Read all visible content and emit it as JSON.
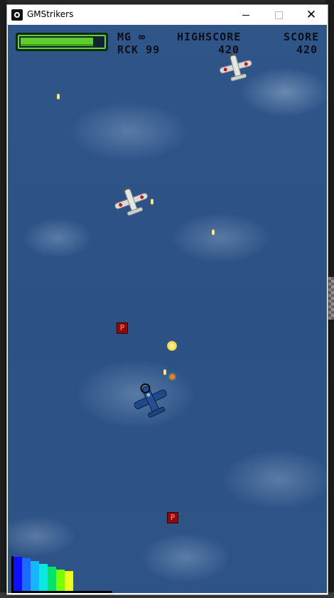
{
  "window": {
    "title": "GMStrikers",
    "minimize_label": "",
    "maximize_label": "",
    "close_label": "✕"
  },
  "hud": {
    "mg": "MG ∞",
    "rck": "RCK 99",
    "highscore_label": "HIGHSCORE",
    "highscore_value": "420",
    "score_label": "SCORE",
    "score_value": "420",
    "health_fraction": 0.88
  },
  "power_meter": {
    "colors": [
      "#1010ff",
      "#1a6bff",
      "#17b4ff",
      "#0be8e0",
      "#00e46a",
      "#7aff00",
      "#e8ff20"
    ],
    "filled_levels": 7
  },
  "entities": {
    "pickup_label": "P",
    "icons": [
      "enemy-plane-icon",
      "player-plane-icon",
      "bullet-icon",
      "pickup-icon"
    ]
  }
}
